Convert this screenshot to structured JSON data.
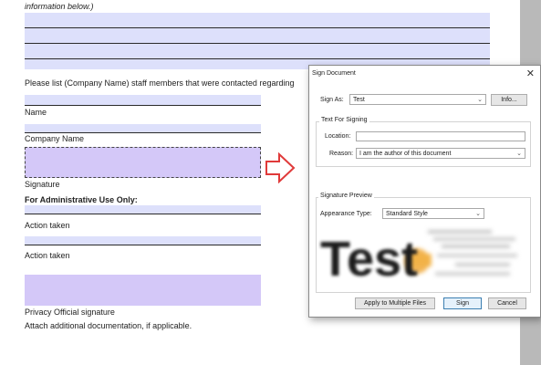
{
  "document": {
    "intro_text": "information below.)",
    "question_text": "Please list (Company Name) staff members that were contacted regarding",
    "label_name": "Name",
    "label_company": "Company Name",
    "label_signature": "Signature",
    "admin_heading": "For Administrative Use Only:",
    "label_action_1": "Action taken",
    "label_action_2": "Action taken",
    "label_privacy": "Privacy Official signature",
    "attach_text": "Attach additional documentation, if applicable."
  },
  "dialog": {
    "title": "Sign Document",
    "close_glyph": "✕",
    "sign_as_label": "Sign As:",
    "sign_as_value": "Test",
    "info_button": "Info...",
    "text_for_signing_title": "Text For Signing",
    "location_label": "Location:",
    "location_value": "",
    "reason_label": "Reason:",
    "reason_value": "I am the author of this document",
    "preview_title": "Signature Preview",
    "appearance_label": "Appearance Type:",
    "appearance_value": "Standard Style",
    "preview_big_text": "Test",
    "apply_button": "Apply to Multiple Files",
    "sign_button": "Sign",
    "cancel_button": "Cancel"
  },
  "colors": {
    "field_fill": "#dde0fb",
    "signature_fill": "#d4c8f8",
    "arrow_red": "#e03a3a",
    "scrollbar": "#b9b9b9"
  }
}
